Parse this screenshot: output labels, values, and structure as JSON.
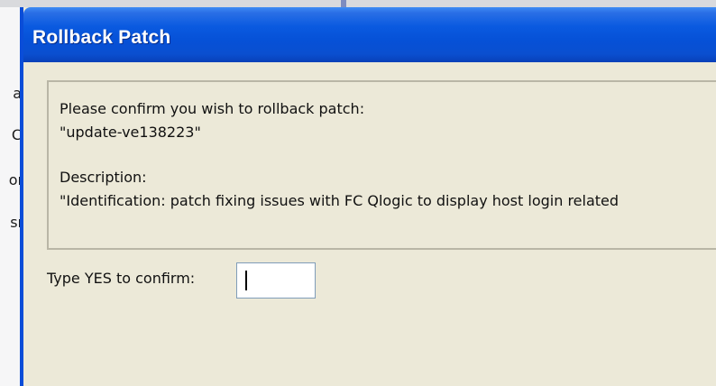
{
  "background": {
    "partial_labels": [
      "a",
      "C",
      "oı",
      "sı"
    ]
  },
  "dialog": {
    "title": "Rollback Patch",
    "message": {
      "line1": "Please confirm you wish to rollback patch:",
      "patch_name": "\"update-ve138223\"",
      "description_label": "Description:",
      "description_text": "\"Identification: patch fixing issues with FC Qlogic to display host login related"
    },
    "confirm": {
      "label": "Type YES to confirm:",
      "value": ""
    }
  }
}
